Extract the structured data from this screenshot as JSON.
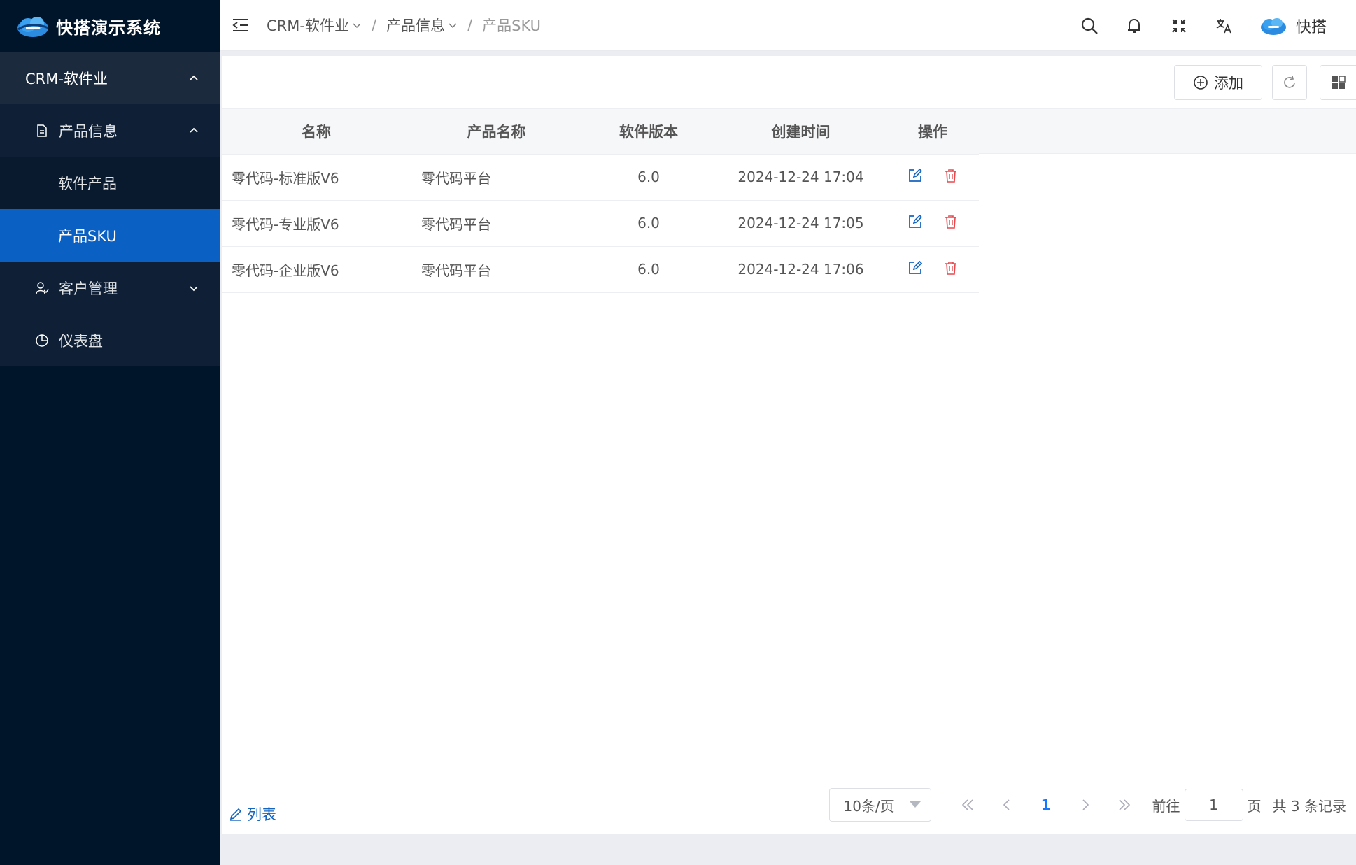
{
  "app": {
    "title": "快搭演示系统"
  },
  "sidebar": {
    "group": "CRM-软件业",
    "items": [
      {
        "label": "产品信息"
      },
      {
        "label": "软件产品"
      },
      {
        "label": "产品SKU"
      },
      {
        "label": "客户管理"
      },
      {
        "label": "仪表盘"
      }
    ]
  },
  "header": {
    "breadcrumb": [
      "CRM-软件业",
      "产品信息",
      "产品SKU"
    ],
    "user": "快搭"
  },
  "toolbar": {
    "add_label": "添加"
  },
  "table": {
    "columns": [
      "名称",
      "产品名称",
      "软件版本",
      "创建时间",
      "操作"
    ],
    "rows": [
      {
        "name": "零代码-标准版V6",
        "product": "零代码平台",
        "version": "6.0",
        "created": "2024-12-24 17:04"
      },
      {
        "name": "零代码-专业版V6",
        "product": "零代码平台",
        "version": "6.0",
        "created": "2024-12-24 17:05"
      },
      {
        "name": "零代码-企业版V6",
        "product": "零代码平台",
        "version": "6.0",
        "created": "2024-12-24 17:06"
      }
    ]
  },
  "footer": {
    "view_label": "列表",
    "page_size": "10条/页",
    "current_page": "1",
    "goto_label": "前往",
    "goto_value": "1",
    "page_unit": "页",
    "total": "共 3 条记录"
  },
  "colors": {
    "sidebar": "#001529",
    "active": "#0b60c4",
    "primary": "#1565c0",
    "danger": "#e5484d"
  }
}
